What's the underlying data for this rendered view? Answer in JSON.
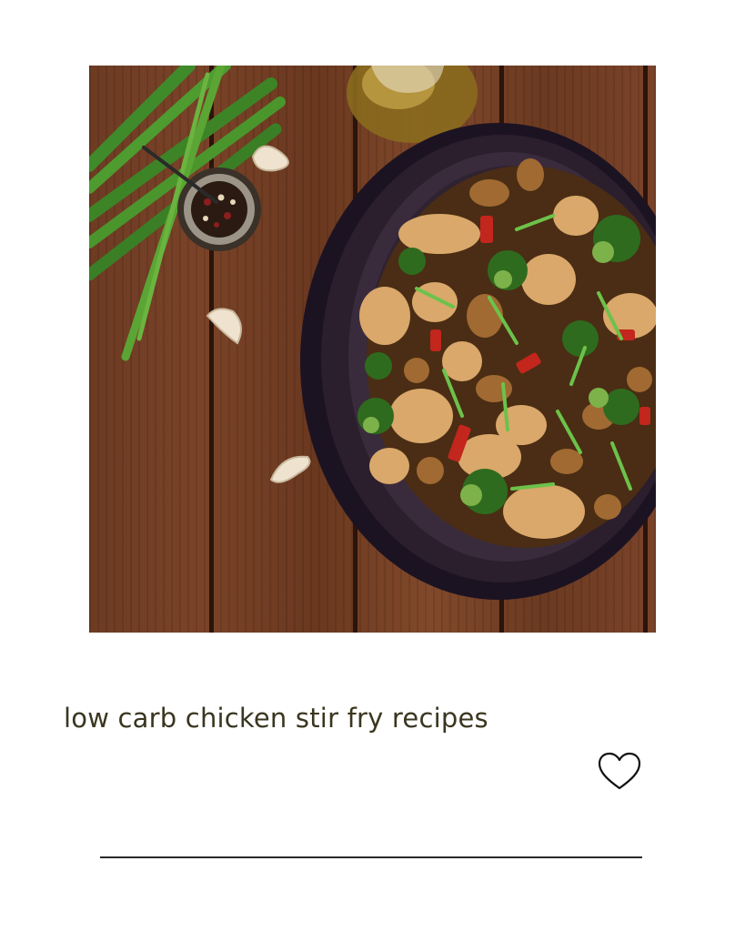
{
  "card": {
    "image_alt": "Stir-fried chicken with mushrooms, broccoli and red pepper in a dark plate on a wooden table",
    "title": "low carb chicken stir fry recipes",
    "like_icon": "heart-outline-icon"
  },
  "colors": {
    "title_text": "#3a3620",
    "divider": "#2a2a2a",
    "wood": "#7a4328",
    "plate": "#2b1e2d"
  }
}
